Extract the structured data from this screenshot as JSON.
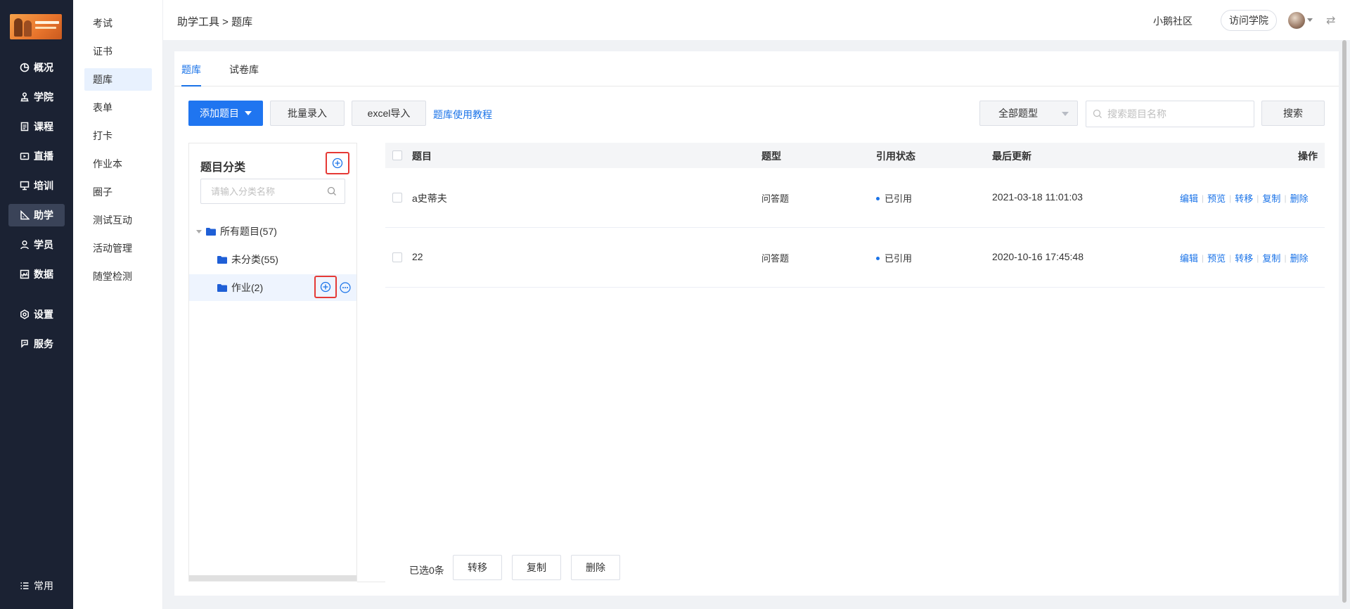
{
  "sidebar": {
    "items": [
      {
        "label": "概况",
        "icon": "pie-chart-icon"
      },
      {
        "label": "学院",
        "icon": "network-icon"
      },
      {
        "label": "课程",
        "icon": "document-icon"
      },
      {
        "label": "直播",
        "icon": "video-icon"
      },
      {
        "label": "培训",
        "icon": "presentation-icon"
      },
      {
        "label": "助学",
        "icon": "ruler-icon",
        "active": true
      },
      {
        "label": "学员",
        "icon": "user-icon"
      },
      {
        "label": "数据",
        "icon": "chart-icon"
      },
      {
        "label": "设置",
        "icon": "gear-icon"
      },
      {
        "label": "服务",
        "icon": "service-icon"
      }
    ],
    "bottom": {
      "label": "常用",
      "icon": "list-icon"
    }
  },
  "subnav": {
    "items": [
      "考试",
      "证书",
      "题库",
      "表单",
      "打卡",
      "作业本",
      "圈子",
      "测试互动",
      "活动管理",
      "随堂检测"
    ],
    "active_index": 2
  },
  "header": {
    "breadcrumb": "助学工具 > 题库",
    "community": "小鹅社区",
    "visit": "访问学院"
  },
  "tabs": [
    "题库",
    "试卷库"
  ],
  "toolbar": {
    "add": "添加题目",
    "batch": "批量录入",
    "excel": "excel导入",
    "tutorial": "题库使用教程",
    "type_select": "全部题型",
    "search_placeholder": "搜索题目名称",
    "search": "搜索"
  },
  "category": {
    "title": "题目分类",
    "search_placeholder": "请输入分类名称",
    "tree": [
      {
        "label": "所有题目(57)",
        "level": 0
      },
      {
        "label": "未分类(55)",
        "level": 1
      },
      {
        "label": "作业(2)",
        "level": 1,
        "active": true
      }
    ]
  },
  "table": {
    "headers": [
      "题目",
      "题型",
      "引用状态",
      "最后更新",
      "操作"
    ],
    "rows": [
      {
        "title": "a史蒂夫",
        "type": "问答题",
        "status": "已引用",
        "updated": "2021-03-18 11:01:03"
      },
      {
        "title": "22",
        "type": "问答题",
        "status": "已引用",
        "updated": "2020-10-16 17:45:48"
      }
    ],
    "ops": [
      "编辑",
      "预览",
      "转移",
      "复制",
      "删除"
    ]
  },
  "footer": {
    "selected": "已选0条",
    "actions": [
      "转移",
      "复制",
      "删除"
    ]
  },
  "colors": {
    "accent": "#1f75f0",
    "sidebar": "#1b2233",
    "highlight_box": "#e53935"
  }
}
